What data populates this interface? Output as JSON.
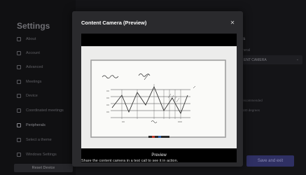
{
  "settings": {
    "title": "Settings",
    "nav_items": [
      {
        "label": "About",
        "icon": "info-icon"
      },
      {
        "label": "Account",
        "icon": "person-icon"
      },
      {
        "label": "Advanced",
        "icon": "sliders-icon"
      },
      {
        "label": "Meetings",
        "icon": "calendar-icon"
      },
      {
        "label": "Device",
        "icon": "monitor-icon"
      },
      {
        "label": "Coordinated meetings",
        "icon": "sync-icon"
      },
      {
        "label": "Peripherals",
        "icon": "peripherals-icon"
      },
      {
        "label": "Select a theme",
        "icon": "palette-icon"
      },
      {
        "label": "Windows Settings",
        "icon": "windows-icon"
      }
    ],
    "active_nav_index": 6,
    "reset_label": "Reset Device",
    "right_panel": {
      "header": "s",
      "label": "neral",
      "select_value": "ENT CAMERA",
      "note_1": "recommended",
      "note_2": "180 degrees",
      "save_label": "Save and exit"
    }
  },
  "modal": {
    "title": "Content Camera (Preview)",
    "close_icon": "close-icon",
    "preview_label": "Preview",
    "hint": "Share the content camera in a test call to see it in action."
  },
  "colors": {
    "modal_bg": "#2a2a2d",
    "accent_button": "#2f3063",
    "whiteboard": "#ececeb"
  }
}
